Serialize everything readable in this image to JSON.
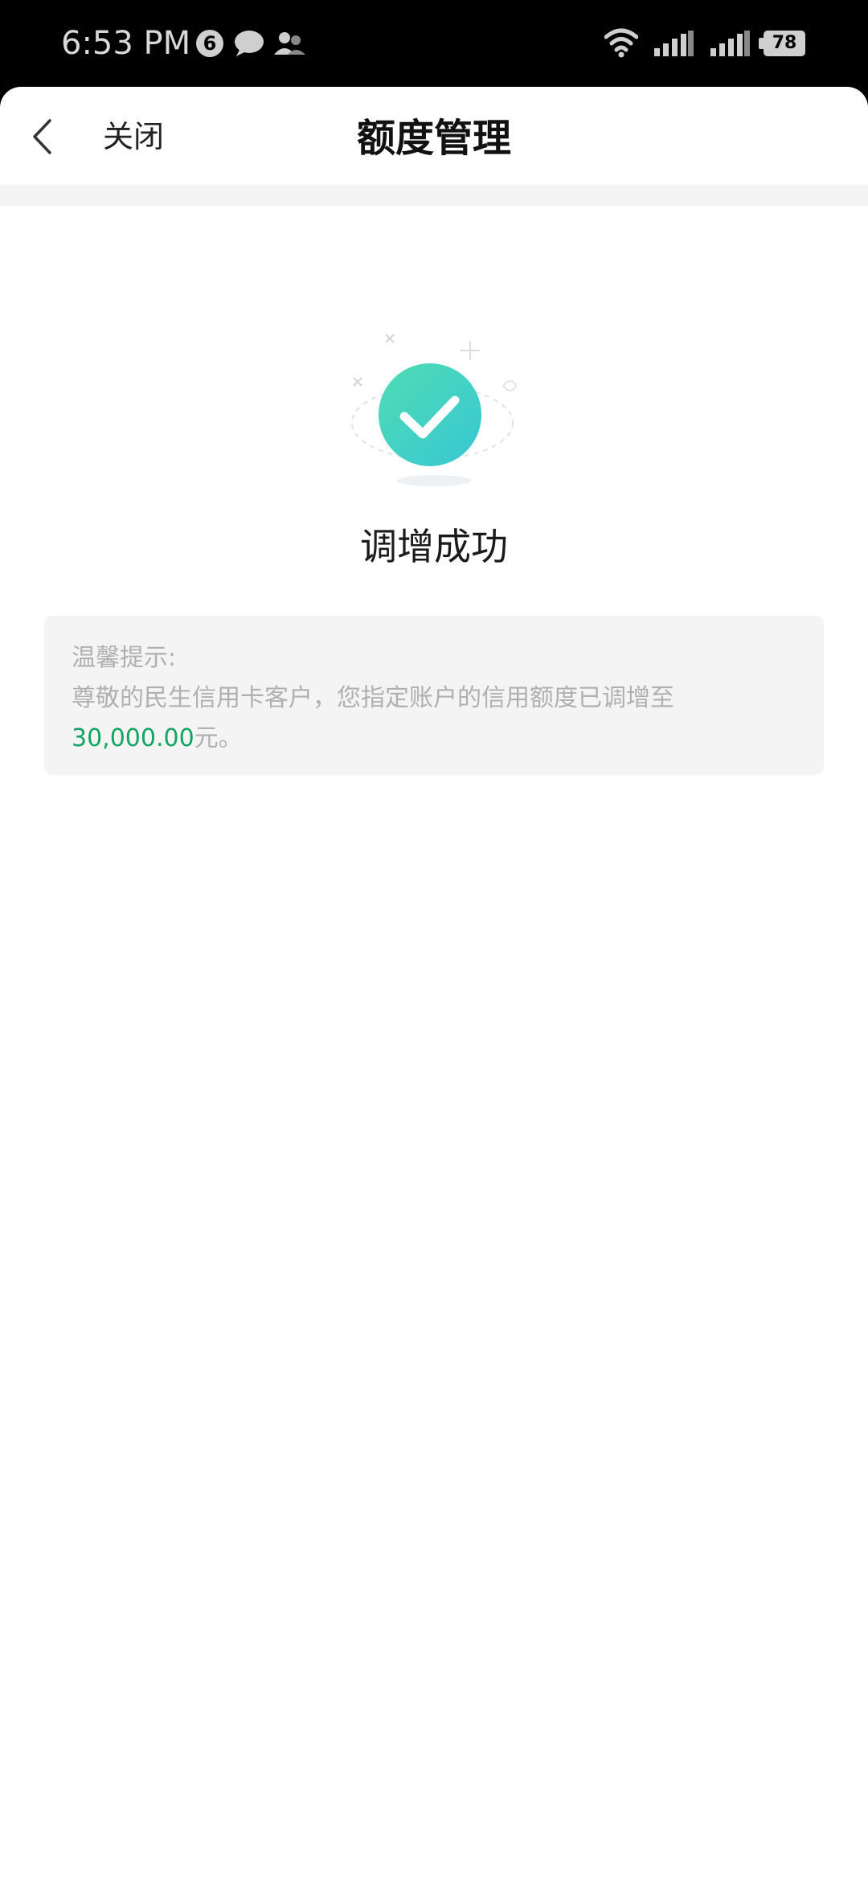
{
  "status_bar": {
    "time": "6:53 PM",
    "notification_count": "6",
    "battery_level": "78",
    "icons": [
      "chat-bubble-icon",
      "contacts-icon",
      "wifi-icon",
      "signal-icon",
      "signal-2-icon",
      "battery-icon"
    ]
  },
  "nav": {
    "close_label": "关闭",
    "title": "额度管理"
  },
  "result": {
    "title": "调增成功",
    "icon": "success-check-icon",
    "accent_colors": [
      "#4fdcb4",
      "#38c7d3"
    ]
  },
  "tip": {
    "heading": "温馨提示:",
    "text_before": "尊敬的民生信用卡客户，您指定账户的信用额度已调增至",
    "amount": "30,000.00",
    "text_after": "元。",
    "amount_color": "#12a561"
  }
}
